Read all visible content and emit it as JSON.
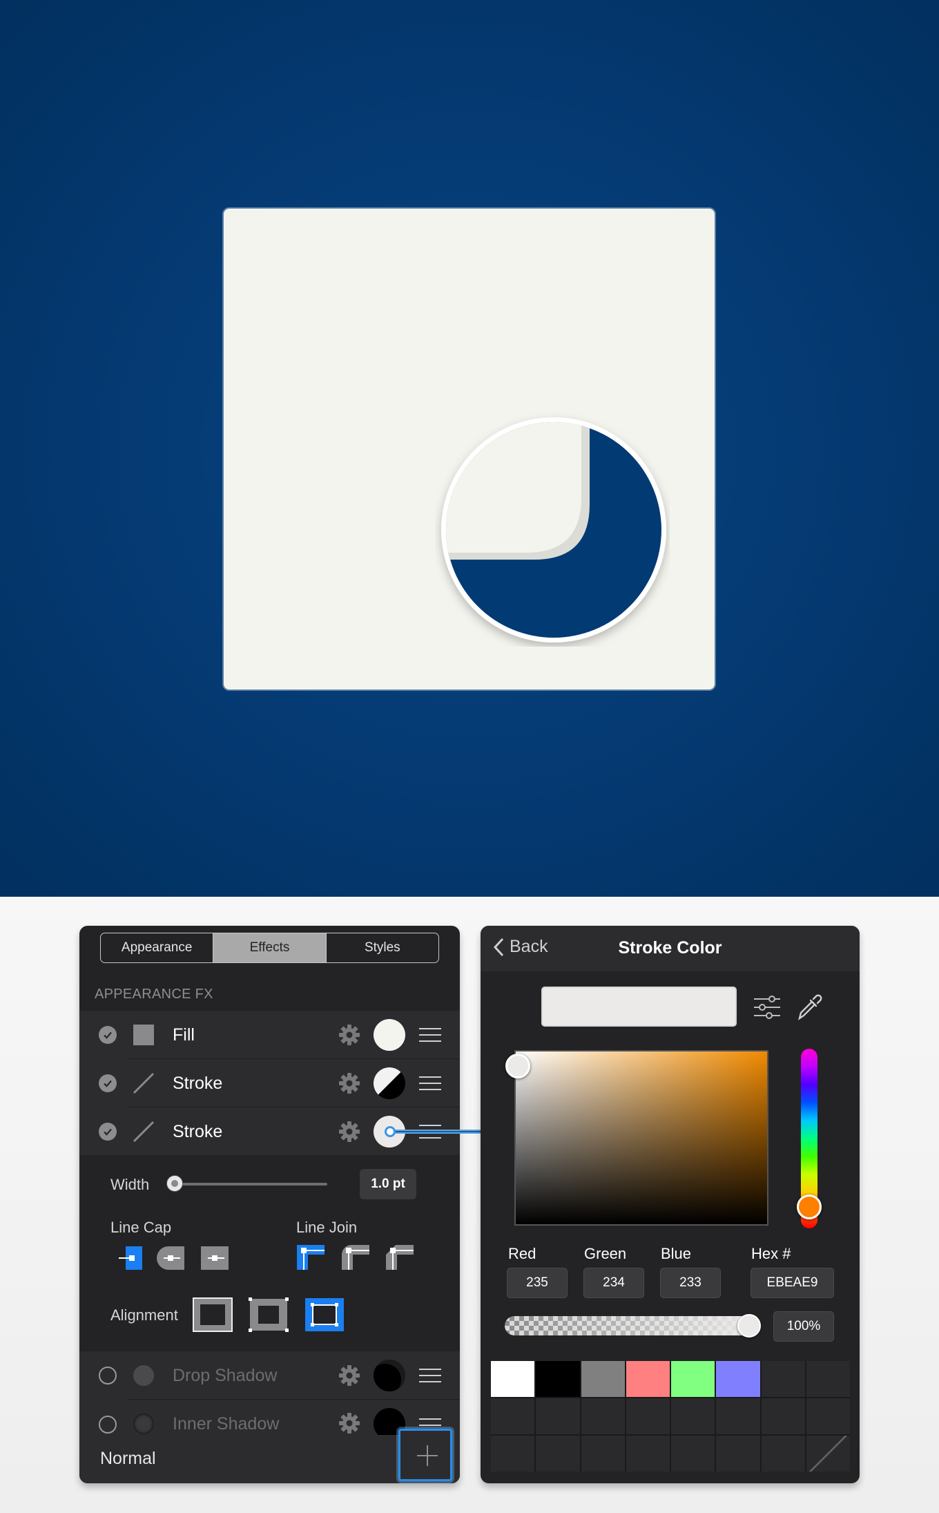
{
  "canvas": {
    "background_color": "#04386f",
    "artboard_color": "#f4f4ef",
    "sticker_color": "#023a74"
  },
  "appearance_panel": {
    "tabs": [
      {
        "label": "Appearance",
        "active": false
      },
      {
        "label": "Effects",
        "active": true
      },
      {
        "label": "Styles",
        "active": false
      }
    ],
    "section_title": "APPEARANCE FX",
    "rows": [
      {
        "label": "Fill",
        "enabled": true,
        "icon": "fill-square-icon",
        "swatch": "#f4f4ef"
      },
      {
        "label": "Stroke",
        "enabled": true,
        "icon": "stroke-line-icon",
        "swatch": "black-white-diagonal"
      },
      {
        "label": "Stroke",
        "enabled": true,
        "icon": "stroke-line-icon",
        "swatch": "#ebeae9"
      }
    ],
    "stroke_settings": {
      "width_label": "Width",
      "width_value": "1.0 pt",
      "width_slider_fraction": 0.0,
      "line_cap_label": "Line Cap",
      "line_join_label": "Line Join",
      "line_cap_selected": "butt",
      "line_join_selected": "miter",
      "alignment_label": "Alignment",
      "alignment_selected": "outside"
    },
    "effects": [
      {
        "label": "Drop Shadow",
        "enabled": false
      },
      {
        "label": "Inner Shadow",
        "enabled": false
      }
    ],
    "blend_mode": "Normal",
    "accent_color": "#1a7ff0"
  },
  "color_panel": {
    "back_label": "Back",
    "title": "Stroke Color",
    "current_color": "#ebeae9",
    "channels": [
      {
        "label": "Red",
        "value": "235"
      },
      {
        "label": "Green",
        "value": "234"
      },
      {
        "label": "Blue",
        "value": "233"
      },
      {
        "label": "Hex #",
        "value": "EBEAE9"
      }
    ],
    "opacity": "100%",
    "opacity_fraction": 1.0,
    "palette": [
      "#ffffff",
      "#000000",
      "#808080",
      "#ff8080",
      "#80ff80",
      "#8080ff"
    ]
  }
}
